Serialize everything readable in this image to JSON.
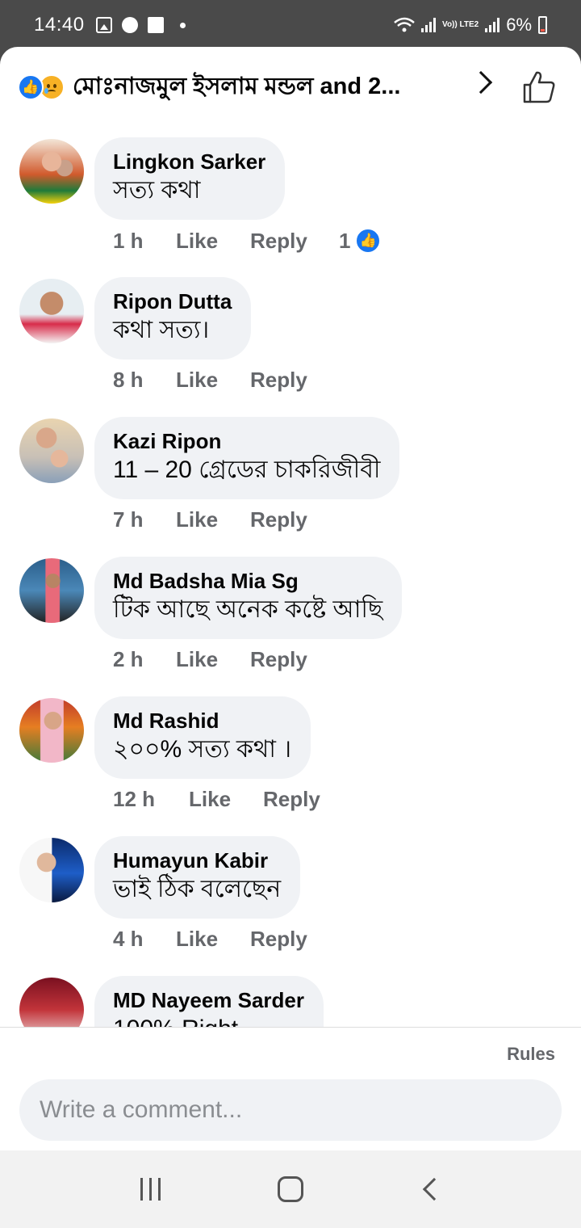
{
  "status_bar": {
    "time": "14:40",
    "network": "Vo)) LTE2",
    "battery": "6%"
  },
  "header": {
    "title": "মোঃনাজমুল ইসলাম মন্ডল and 2..."
  },
  "actions": {
    "like": "Like",
    "reply": "Reply"
  },
  "comments": [
    {
      "name": "Lingkon Sarker",
      "text": "সত্য কথা",
      "time": "1 h",
      "reactions": "1"
    },
    {
      "name": "Ripon Dutta",
      "text": "কথা সত্য।",
      "time": "8 h"
    },
    {
      "name": "Kazi Ripon",
      "text": "11 – 20 গ্রেডের চাকরিজীবী",
      "time": "7 h"
    },
    {
      "name": "Md Badsha Mia Sg",
      "text": "টিক আছে  অনেক কষ্টে আছি",
      "time": "2 h"
    },
    {
      "name": "Md Rashid",
      "text": "২০০% সত্য  কথা ।",
      "time": "12 h"
    },
    {
      "name": "Humayun Kabir",
      "text": "ভাই ঠিক বলেছেন",
      "time": "4 h"
    },
    {
      "name": "MD Nayeem Sarder",
      "text": "100% Right"
    }
  ],
  "footer": {
    "rules": "Rules",
    "input_placeholder": "Write a comment..."
  },
  "colors": {
    "accent": "#1877f2",
    "bubble": "#f0f2f5",
    "meta": "#65676b"
  }
}
